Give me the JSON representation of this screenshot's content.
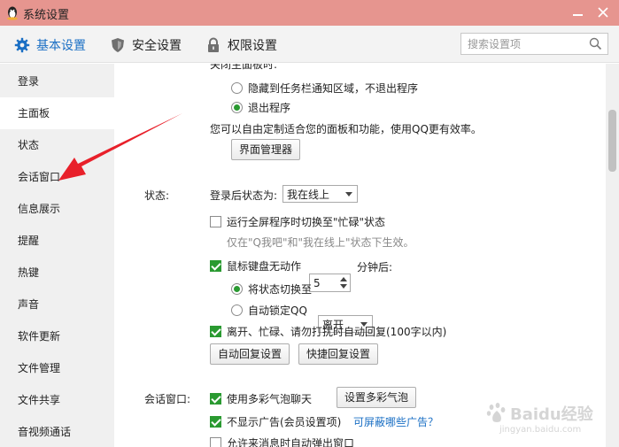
{
  "window": {
    "title": "系统设置"
  },
  "tabs": [
    {
      "label": "基本设置",
      "icon": "gear-icon",
      "active": true
    },
    {
      "label": "安全设置",
      "icon": "shield-icon",
      "active": false
    },
    {
      "label": "权限设置",
      "icon": "lock-icon",
      "active": false
    }
  ],
  "search": {
    "placeholder": "搜索设置项",
    "value": ""
  },
  "sidebar": {
    "items": [
      {
        "label": "登录"
      },
      {
        "label": "主面板",
        "active": true
      },
      {
        "label": "状态"
      },
      {
        "label": "会话窗口"
      },
      {
        "label": "信息展示"
      },
      {
        "label": "提醒"
      },
      {
        "label": "热键"
      },
      {
        "label": "声音"
      },
      {
        "label": "软件更新"
      },
      {
        "label": "文件管理"
      },
      {
        "label": "文件共享"
      },
      {
        "label": "音视频通话"
      }
    ]
  },
  "main_panel": {
    "close_heading": "关闭主面板时:",
    "opt_hide": "隐藏到任务栏通知区域，不退出程序",
    "opt_exit": "退出程序",
    "customize_text": "您可以自由定制适合您的面板和功能，使用QQ更有效率。",
    "ui_manager_button": "界面管理器"
  },
  "status": {
    "section": "状态:",
    "login_status_label": "登录后状态为:",
    "login_status_value": "我在线上",
    "fullscreen_busy": "运行全屏程序时切换至\"忙碌\"状态",
    "fullscreen_hint": "仅在\"Q我吧\"和\"我在线上\"状态下生效。",
    "idle_label": "鼠标键盘无动作",
    "idle_minutes": "5",
    "idle_suffix": "分钟后:",
    "switch_to_label": "将状态切换至",
    "switch_to_value": "离开",
    "auto_lock": "自动锁定QQ",
    "auto_reply": "离开、忙碌、请勿打扰时自动回复(100字以内)",
    "auto_reply_btn": "自动回复设置",
    "quick_reply_btn": "快捷回复设置"
  },
  "chat_window": {
    "section": "会话窗口:",
    "bubble": "使用多彩气泡聊天",
    "bubble_btn": "设置多彩气泡",
    "no_ads": "不显示广告(会员设置项)",
    "ads_link": "可屏蔽哪些广告？",
    "popup": "允许来消息时自动弹出窗口"
  },
  "state": {
    "opt_hide_selected": false,
    "opt_exit_selected": true,
    "fullscreen_busy_checked": false,
    "idle_checked": true,
    "switch_to_selected": true,
    "auto_lock_selected": false,
    "auto_reply_checked": true,
    "bubble_checked": true,
    "no_ads_checked": true,
    "popup_checked": false
  },
  "watermark": {
    "text": "Baidu经验",
    "subtext": "jingyan.baidu.com"
  },
  "colors": {
    "titlebar": "#e6958f",
    "accent": "#1a6fc4",
    "check_green": "#2a9a31",
    "arrow_red": "#e8202a"
  }
}
